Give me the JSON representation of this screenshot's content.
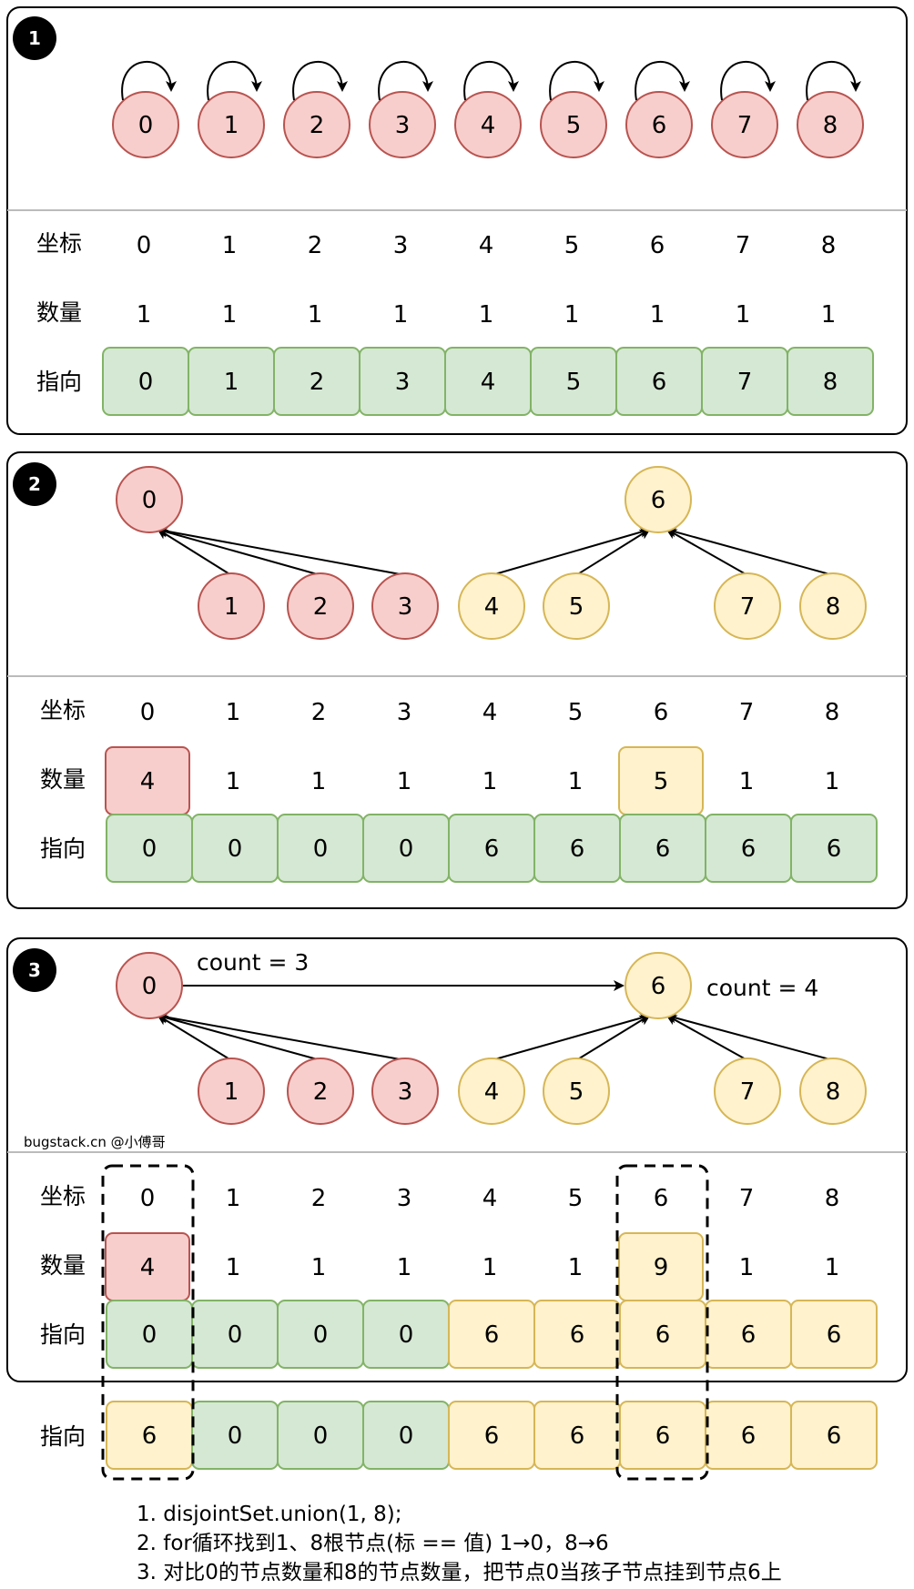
{
  "colors": {
    "red_fill": "#f8cecc",
    "red_stroke": "#b85450",
    "yellow_fill": "#fff2cc",
    "yellow_stroke": "#d6b656",
    "green_fill": "#d5e8d4",
    "green_stroke": "#82b366"
  },
  "row_labels": {
    "index": "坐标",
    "count": "数量",
    "pointer": "指向"
  },
  "panels": [
    {
      "badge": "1",
      "nodes": [
        {
          "label": "0",
          "color": "red"
        },
        {
          "label": "1",
          "color": "red"
        },
        {
          "label": "2",
          "color": "red"
        },
        {
          "label": "3",
          "color": "red"
        },
        {
          "label": "4",
          "color": "red"
        },
        {
          "label": "5",
          "color": "red"
        },
        {
          "label": "6",
          "color": "red"
        },
        {
          "label": "7",
          "color": "red"
        },
        {
          "label": "8",
          "color": "red"
        }
      ],
      "index": [
        "0",
        "1",
        "2",
        "3",
        "4",
        "5",
        "6",
        "7",
        "8"
      ],
      "count": [
        "1",
        "1",
        "1",
        "1",
        "1",
        "1",
        "1",
        "1",
        "1"
      ],
      "pointer": [
        "0",
        "1",
        "2",
        "3",
        "4",
        "5",
        "6",
        "7",
        "8"
      ],
      "pointer_colors": [
        "green",
        "green",
        "green",
        "green",
        "green",
        "green",
        "green",
        "green",
        "green"
      ]
    },
    {
      "badge": "2",
      "roots": [
        {
          "label": "0",
          "color": "red"
        },
        {
          "label": "6",
          "color": "yellow"
        }
      ],
      "children": [
        {
          "label": "1",
          "color": "red"
        },
        {
          "label": "2",
          "color": "red"
        },
        {
          "label": "3",
          "color": "red"
        },
        {
          "label": "4",
          "color": "yellow"
        },
        {
          "label": "5",
          "color": "yellow"
        },
        {
          "label": "7",
          "color": "yellow"
        },
        {
          "label": "8",
          "color": "yellow"
        }
      ],
      "index": [
        "0",
        "1",
        "2",
        "3",
        "4",
        "5",
        "6",
        "7",
        "8"
      ],
      "count": [
        "4",
        "1",
        "1",
        "1",
        "1",
        "1",
        "5",
        "1",
        "1"
      ],
      "count_colors": [
        "red",
        null,
        null,
        null,
        null,
        null,
        "yellow",
        null,
        null
      ],
      "pointer": [
        "0",
        "0",
        "0",
        "0",
        "6",
        "6",
        "6",
        "6",
        "6"
      ],
      "pointer_colors": [
        "green",
        "green",
        "green",
        "green",
        "green",
        "green",
        "green",
        "green",
        "green"
      ]
    },
    {
      "badge": "3",
      "roots": [
        {
          "label": "0",
          "color": "red"
        },
        {
          "label": "6",
          "color": "yellow"
        }
      ],
      "children": [
        {
          "label": "1",
          "color": "red"
        },
        {
          "label": "2",
          "color": "red"
        },
        {
          "label": "3",
          "color": "red"
        },
        {
          "label": "4",
          "color": "yellow"
        },
        {
          "label": "5",
          "color": "yellow"
        },
        {
          "label": "7",
          "color": "yellow"
        },
        {
          "label": "8",
          "color": "yellow"
        }
      ],
      "count_label_0": "count = 3",
      "count_label_6": "count = 4",
      "watermark": "bugstack.cn @小傅哥",
      "index": [
        "0",
        "1",
        "2",
        "3",
        "4",
        "5",
        "6",
        "7",
        "8"
      ],
      "count": [
        "4",
        "1",
        "1",
        "1",
        "1",
        "1",
        "9",
        "1",
        "1"
      ],
      "count_colors": [
        "red",
        null,
        null,
        null,
        null,
        null,
        "yellow",
        null,
        null
      ],
      "pointer": [
        "0",
        "0",
        "0",
        "0",
        "6",
        "6",
        "6",
        "6",
        "6"
      ],
      "pointer_colors": [
        "green",
        "green",
        "green",
        "green",
        "yellow",
        "yellow",
        "yellow",
        "yellow",
        "yellow"
      ]
    }
  ],
  "result": {
    "pointer": [
      "6",
      "0",
      "0",
      "0",
      "6",
      "6",
      "6",
      "6",
      "6"
    ],
    "pointer_colors": [
      "yellow",
      "green",
      "green",
      "green",
      "yellow",
      "yellow",
      "yellow",
      "yellow",
      "yellow"
    ]
  },
  "notes": [
    "1. disjointSet.union(1, 8);",
    "2. for循环找到1、8根节点(标 == 值) 1→0，8→6",
    "3. 对比0的节点数量和8的节点数量，把节点0当孩子节点挂到节点6上"
  ]
}
